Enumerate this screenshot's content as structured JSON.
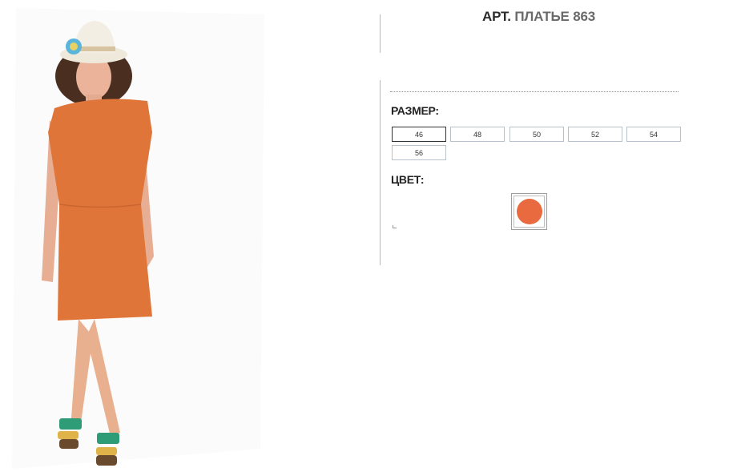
{
  "product": {
    "title_prefix": "АРТ.",
    "title_code": "ПЛАТЬЕ 863"
  },
  "size_section": {
    "label": "РАЗМЕР:",
    "options": [
      "46",
      "48",
      "50",
      "52",
      "54",
      "56"
    ],
    "selected": "46"
  },
  "color_section": {
    "label": "ЦВЕТ:",
    "swatch_color": "#e86a3e"
  },
  "photo": {
    "icon": "model-photo",
    "dress_color": "#e07539",
    "hat_color": "#f1ece1"
  }
}
